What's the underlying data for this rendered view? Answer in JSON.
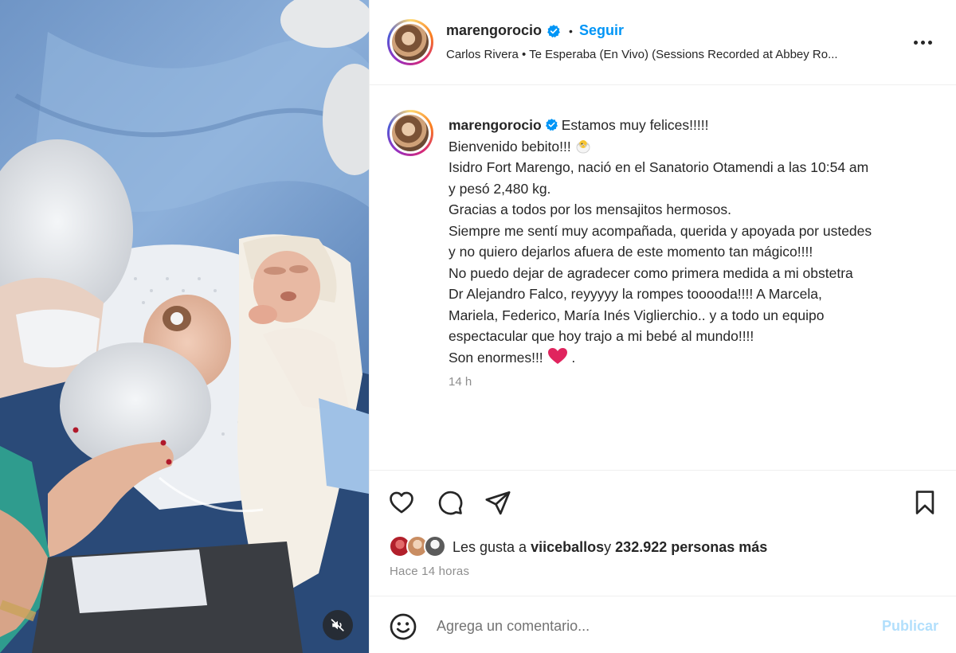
{
  "post": {
    "username": "marengorocio",
    "separator": "•",
    "follow_label": "Seguir",
    "audio": "Carlos Rivera • Te Esperaba (En Vivo) (Sessions Recorded at Abbey Ro..."
  },
  "caption": {
    "username": "marengorocio",
    "lines": [
      "Estamos muy felices!!!!!",
      "Bienvenido bebito!!!",
      "Isidro Fort Marengo, nació en el Sanatorio Otamendi a las 10:54 am",
      "y pesó 2,480 kg.",
      "Gracias a todos por los mensajitos hermosos.",
      "Siempre me sentí muy acompañada, querida y apoyada por ustedes",
      "y no quiero dejarlos afuera de este momento tan mágico!!!!",
      "No puedo dejar de agradecer como primera medida a mi obstetra",
      "Dr Alejandro Falco, reyyyyy la rompes tooooda!!!! A Marcela,",
      "Mariela, Federico, María Inés Viglierchio.. y a todo un equipo",
      "espectacular que hoy trajo a mi bebé al mundo!!!!",
      "Son enormes!!!",
      "."
    ],
    "time": "14 h"
  },
  "likes": {
    "prefix": "Les gusta a ",
    "user": "viiceballos",
    "middle": " y ",
    "count": "232.922 personas más"
  },
  "posted_ago": "Hace 14 horas",
  "comment": {
    "placeholder": "Agrega un comentario...",
    "publish_label": "Publicar"
  },
  "colors": {
    "accent": "#0095f6",
    "publish_disabled": "#b2dffc",
    "muted_text": "#8e8e8e",
    "heart": "#e0245e"
  },
  "icons": [
    "verified-badge-icon",
    "more-options-icon",
    "heart-icon",
    "comment-icon",
    "share-icon",
    "bookmark-icon",
    "emoji-icon",
    "muted-speaker-icon"
  ]
}
